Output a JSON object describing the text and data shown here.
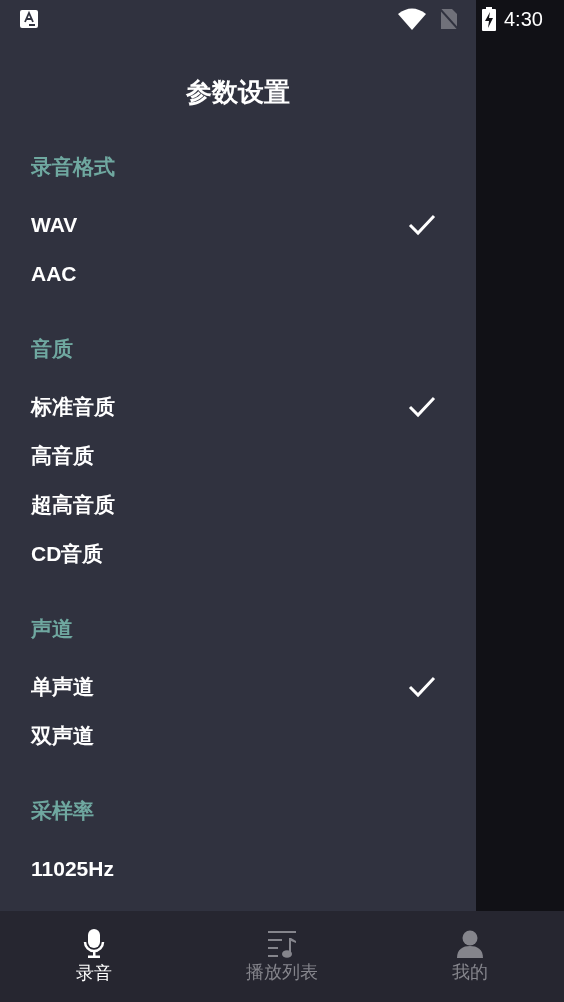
{
  "status_bar": {
    "time": "4:30"
  },
  "title": "参数设置",
  "sections": [
    {
      "header": "录音格式",
      "options": [
        {
          "label": "WAV",
          "selected": true
        },
        {
          "label": "AAC",
          "selected": false
        }
      ]
    },
    {
      "header": "音质",
      "options": [
        {
          "label": "标准音质",
          "selected": true
        },
        {
          "label": "高音质",
          "selected": false
        },
        {
          "label": "超高音质",
          "selected": false
        },
        {
          "label": "CD音质",
          "selected": false
        }
      ]
    },
    {
      "header": "声道",
      "options": [
        {
          "label": "单声道",
          "selected": true
        },
        {
          "label": "双声道",
          "selected": false
        }
      ]
    },
    {
      "header": "采样率",
      "options": [
        {
          "label": "11025Hz",
          "selected": false
        }
      ]
    }
  ],
  "nav": [
    {
      "kind": "mic",
      "label": "录音",
      "selected": true
    },
    {
      "kind": "playlist",
      "label": "播放列表",
      "selected": false
    },
    {
      "kind": "person",
      "label": "我的",
      "selected": false
    }
  ]
}
